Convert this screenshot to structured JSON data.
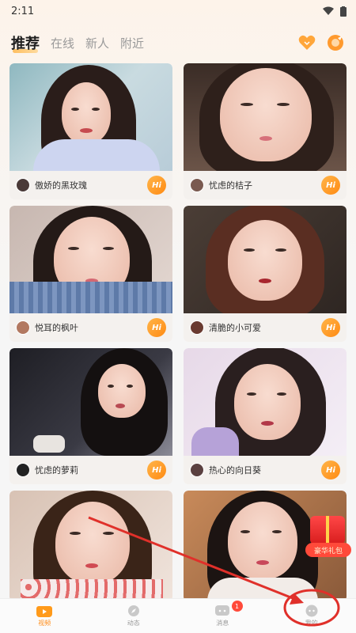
{
  "status_bar": {
    "time": "2:11"
  },
  "tabs": [
    {
      "label": "推荐",
      "active": true
    },
    {
      "label": "在线",
      "active": false
    },
    {
      "label": "新人",
      "active": false
    },
    {
      "label": "附近",
      "active": false
    }
  ],
  "top_icons": [
    {
      "icon": "heart-match-icon",
      "color": "#ff9a2e"
    },
    {
      "icon": "compass-icon",
      "color": "#ff9a2e"
    }
  ],
  "cards": [
    {
      "name": "傲娇的黑玫瑰",
      "hi_label": "Hi"
    },
    {
      "name": "忧虑的桔子",
      "hi_label": "Hi"
    },
    {
      "name": "悦耳的枫叶",
      "hi_label": "Hi"
    },
    {
      "name": "清脆的小可爱",
      "hi_label": "Hi"
    },
    {
      "name": "忧虑的萝莉",
      "hi_label": "Hi"
    },
    {
      "name": "热心的向日葵",
      "hi_label": "Hi"
    },
    {
      "name": "",
      "hi_label": ""
    },
    {
      "name": "",
      "hi_label": ""
    }
  ],
  "gift_badge": {
    "label": "豪华礼包"
  },
  "bottom_nav": [
    {
      "label": "视频",
      "icon": "video-icon",
      "active": true,
      "badge": ""
    },
    {
      "label": "动态",
      "icon": "moments-icon",
      "active": false,
      "badge": ""
    },
    {
      "label": "消息",
      "icon": "message-icon",
      "active": false,
      "badge": "1"
    },
    {
      "label": "我的",
      "icon": "profile-icon",
      "active": false,
      "badge": ""
    }
  ],
  "colors": {
    "accent": "#ff8d1a",
    "annotation_red": "#e0302a"
  }
}
